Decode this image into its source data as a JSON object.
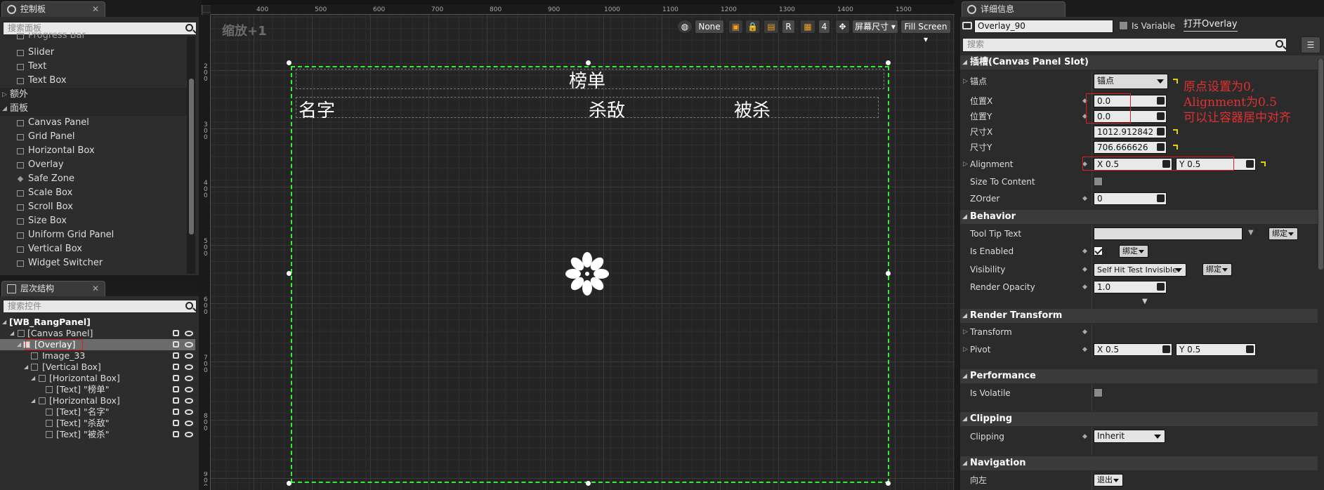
{
  "palette": {
    "tab_title": "控制板",
    "search_placeholder": "搜索面板",
    "items_common": [
      "Progress Bar",
      "Slider",
      "Text",
      "Text Box"
    ],
    "cat_extra": "额外",
    "cat_panel": "面板",
    "items_panel": [
      "Canvas Panel",
      "Grid Panel",
      "Horizontal Box",
      "Overlay",
      "Safe Zone",
      "Scale Box",
      "Scroll Box",
      "Size Box",
      "Uniform Grid Panel",
      "Vertical Box",
      "Widget Switcher"
    ]
  },
  "hierarchy": {
    "tab_title": "层次结构",
    "search_placeholder": "搜索控件",
    "rows": [
      "[WB_RangPanel]",
      "[Canvas Panel]",
      "[Overlay]",
      "Image_33",
      "[Vertical Box]",
      "[Horizontal Box]",
      "[Text] \"榜单\"",
      "[Horizontal Box]",
      "[Text] \"名字\"",
      "[Text] \"杀敌\"",
      "[Text] \"被杀\""
    ]
  },
  "designer": {
    "zoom_label": "缩放+1",
    "ruler_top": [
      "400",
      "500",
      "600",
      "700",
      "800",
      "900",
      "1000",
      "1100",
      "1200",
      "1300",
      "1400",
      "1500"
    ],
    "ruler_left": [
      "200",
      "300",
      "400",
      "500",
      "600",
      "700",
      "800",
      "900"
    ],
    "toolbar": {
      "none": "None",
      "r": "R",
      "four": "4",
      "screen_size": "屏幕尺寸",
      "fill_screen": "Fill Screen"
    },
    "widget_title": "榜单",
    "col_name": "名字",
    "col_kills": "杀敌",
    "col_killed": "被杀"
  },
  "details": {
    "tab_title": "详细信息",
    "widget_name": "Overlay_90",
    "is_variable": "Is Variable",
    "open_link": "打开Overlay",
    "search_placeholder": "搜索",
    "slot_section": "插槽(Canvas Panel Slot)",
    "anchor_label": "锚点",
    "anchor_value": "锚点",
    "pos_x_label": "位置X",
    "pos_x": "0.0",
    "pos_y_label": "位置Y",
    "pos_y": "0.0",
    "size_x_label": "尺寸X",
    "size_x": "1012.912842",
    "size_y_label": "尺寸Y",
    "size_y": "706.666626",
    "alignment_label": "Alignment",
    "align_x": "X  0.5",
    "align_y": "Y  0.5",
    "size_to_content": "Size To Content",
    "zorder_label": "ZOrder",
    "zorder": "0",
    "behavior": "Behavior",
    "tooltip": "Tool Tip Text",
    "bind": "绑定",
    "is_enabled": "Is Enabled",
    "visibility": "Visibility",
    "visibility_value": "Self Hit Test Invisible",
    "render_opacity": "Render Opacity",
    "opacity_value": "1.0",
    "render_transform": "Render Transform",
    "transform": "Transform",
    "pivot": "Pivot",
    "pivot_x": "X  0.5",
    "pivot_y": "Y  0.5",
    "performance": "Performance",
    "is_volatile": "Is Volatile",
    "clipping_section": "Clipping",
    "clipping": "Clipping",
    "clipping_value": "Inherit",
    "navigation": "Navigation",
    "nav_left": "向左",
    "nav_left_value": "退出"
  },
  "annotation": [
    "原点设置为0,",
    "Alignment为0.5",
    "可以让容器居中对齐"
  ],
  "colors": {
    "selection": "#33ee33",
    "annotation": "#e03030"
  }
}
